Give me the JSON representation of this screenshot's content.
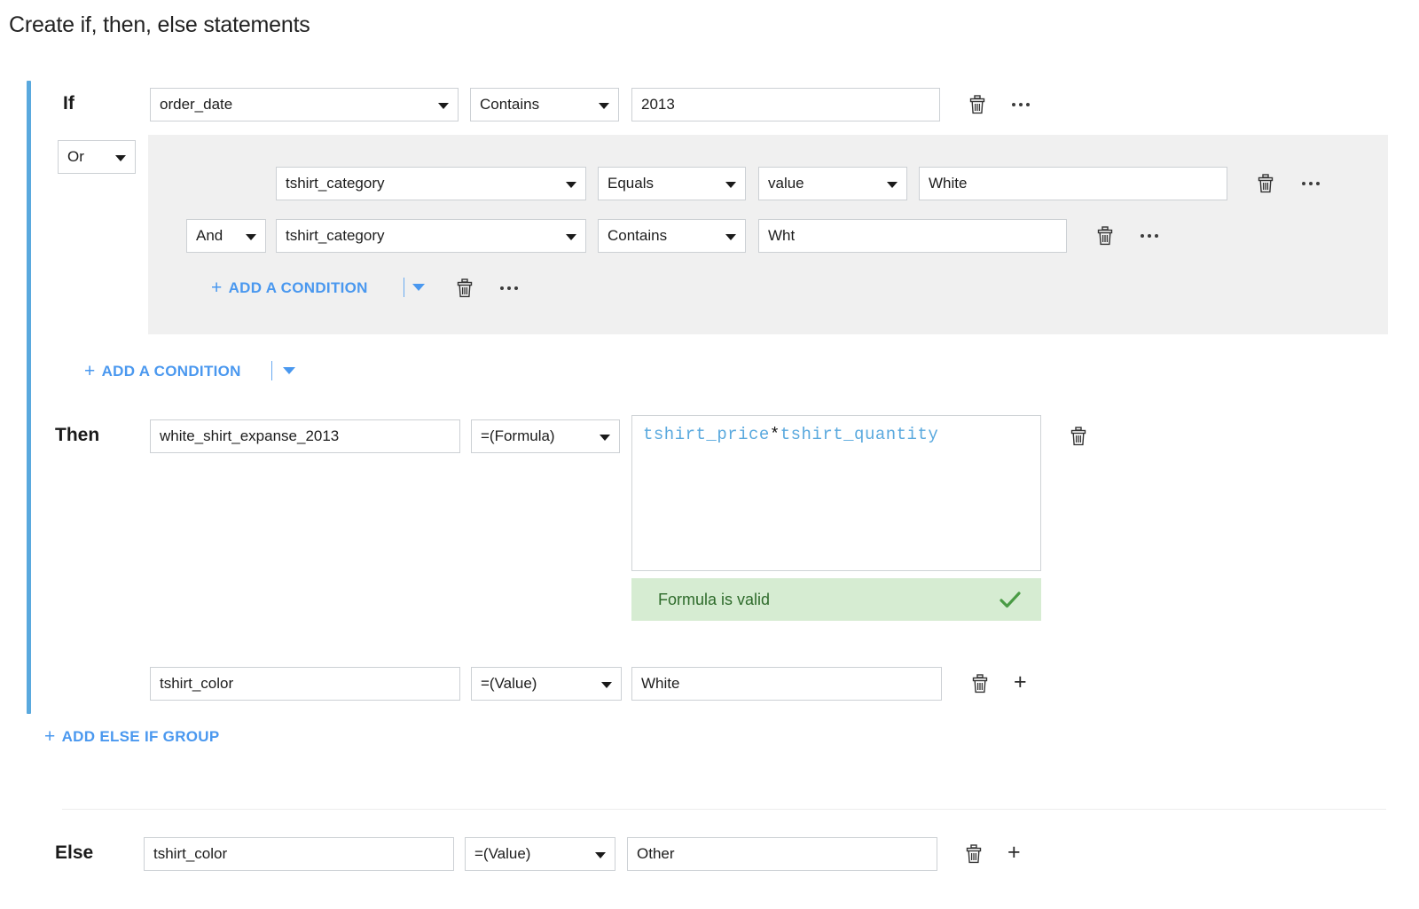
{
  "page": {
    "title": "Create if, then, else statements",
    "accent_color": "#5aa9de",
    "link_color": "#4a98ef",
    "panel_bg": "#f0f0f0",
    "valid_bg": "#d6ecd2",
    "valid_text_color": "#2e6b2b"
  },
  "if_section": {
    "label": "If",
    "condition": {
      "field": "order_date",
      "operator": "Contains",
      "value": "2013"
    },
    "joiner": "Or",
    "nested_group": {
      "rows": [
        {
          "joiner": null,
          "field": "tshirt_category",
          "operator": "Equals",
          "value_type": "value",
          "value": "White"
        },
        {
          "joiner": "And",
          "field": "tshirt_category",
          "operator": "Contains",
          "value_type": null,
          "value": "Wht"
        }
      ],
      "add_condition_label": "ADD A CONDITION",
      "plus": "+"
    },
    "add_condition_label": "ADD A CONDITION",
    "plus": "+"
  },
  "then_section": {
    "label": "Then",
    "rows": [
      {
        "name": "white_shirt_expanse_2013",
        "type": "=(Formula)",
        "formula_left": "tshirt_price",
        "formula_op": "*",
        "formula_right": "tshirt_quantity",
        "validation": "Formula is valid",
        "check_icon": "check-icon"
      },
      {
        "name": "tshirt_color",
        "type": "=(Value)",
        "value": "White"
      }
    ],
    "add_else_if_label": "ADD ELSE IF GROUP",
    "plus": "+"
  },
  "else_section": {
    "label": "Else",
    "row": {
      "name": "tshirt_color",
      "type": "=(Value)",
      "value": "Other"
    }
  },
  "icons": {
    "trash": "trash-icon",
    "more": "more-options-icon",
    "add": "+",
    "caret": "chevron-down-icon"
  }
}
